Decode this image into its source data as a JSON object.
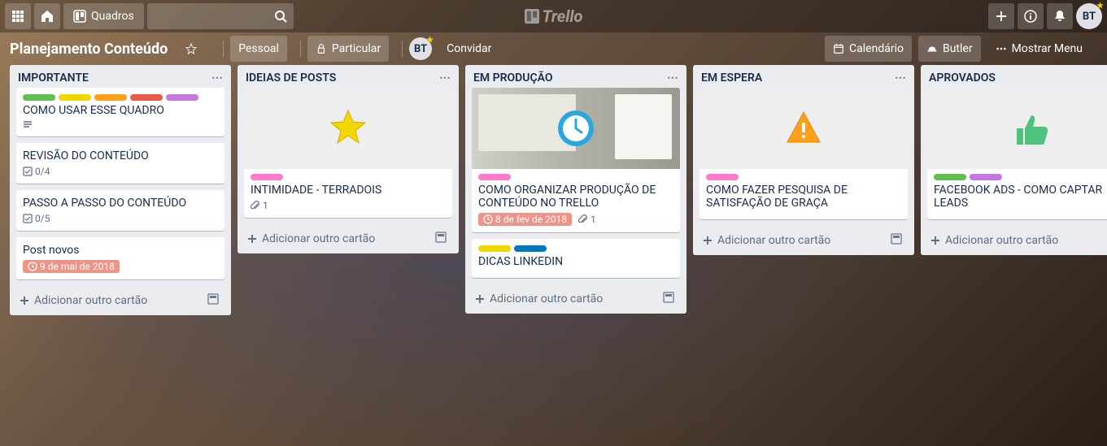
{
  "header": {
    "boards_label": "Quadros",
    "logo_text": "Trello"
  },
  "board_header": {
    "title": "Planejamento Conteúdo",
    "visibility_team": "Pessoal",
    "visibility_private": "Particular",
    "invite": "Convidar",
    "avatar_initials": "BT",
    "calendar": "Calendário",
    "butler": "Butler",
    "show_menu": "Mostrar Menu"
  },
  "top_avatar": "BT",
  "colors": {
    "green": "#61bd4f",
    "yellow": "#f2d600",
    "orange": "#ff9f1a",
    "red": "#eb5a46",
    "purple": "#c377e0",
    "blue": "#0079bf",
    "pink": "#ff78cb"
  },
  "add_card_label": "Adicionar outro cartão",
  "lists": [
    {
      "title": "IMPORTANTE",
      "cards": [
        {
          "labels": [
            "green",
            "yellow",
            "orange",
            "red",
            "purple"
          ],
          "title": "COMO USAR ESSE QUADRO",
          "desc": true
        },
        {
          "title": "REVISÃO DO CONTEÚDO",
          "checklist": "0/4"
        },
        {
          "title": "PASSO A PASSO DO CONTEÚDO",
          "checklist": "0/5"
        },
        {
          "title": "Post novos",
          "due": "9 de mai de 2018"
        }
      ]
    },
    {
      "title": "IDEIAS DE POSTS",
      "cards": [
        {
          "cover": "star",
          "labels": [
            "pink"
          ],
          "title": "INTIMIDADE - TERRADOIS",
          "attachments": "1"
        }
      ]
    },
    {
      "title": "EM PRODUÇÃO",
      "cards": [
        {
          "cover": "screenshot",
          "labels": [
            "pink"
          ],
          "title": "COMO ORGANIZAR PRODUÇÃO DE CONTEÚDO NO TRELLO",
          "due": "8 de fev de 2018",
          "attachments": "1"
        },
        {
          "labels": [
            "yellow",
            "blue"
          ],
          "title": "DICAS LINKEDIN"
        }
      ]
    },
    {
      "title": "EM ESPERA",
      "cards": [
        {
          "cover": "warning",
          "labels": [
            "pink"
          ],
          "title": "COMO FAZER PESQUISA DE SATISFAÇÃO DE GRAÇA"
        }
      ]
    },
    {
      "title": "APROVADOS",
      "cards": [
        {
          "cover": "thumb",
          "labels": [
            "green",
            "purple"
          ],
          "title": "FACEBOOK ADS - COMO CAPTAR LEADS"
        }
      ]
    }
  ]
}
